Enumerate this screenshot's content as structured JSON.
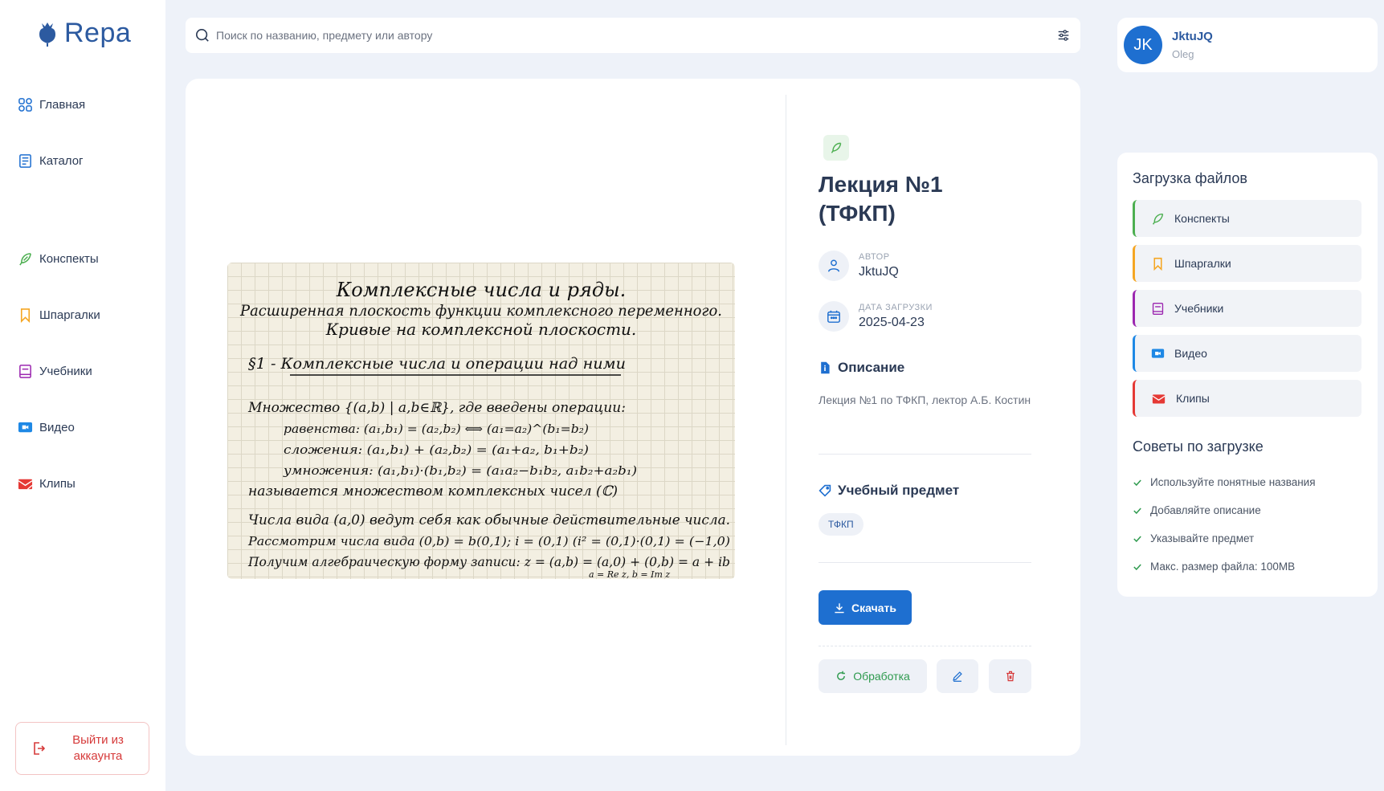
{
  "app": {
    "name": "Repa"
  },
  "sidebar": {
    "items": [
      {
        "label": "Главная",
        "icon": "grid-icon"
      },
      {
        "label": "Каталог",
        "icon": "catalog-icon"
      },
      {
        "label": "Конспекты",
        "icon": "feather-icon"
      },
      {
        "label": "Шпаргалки",
        "icon": "bookmark-icon"
      },
      {
        "label": "Учебники",
        "icon": "book-icon"
      },
      {
        "label": "Видео",
        "icon": "video-icon"
      },
      {
        "label": "Клипы",
        "icon": "clips-icon"
      }
    ],
    "logout_label": "Выйти из аккаунта"
  },
  "search": {
    "placeholder": "Поиск по названию, предмету или автору"
  },
  "document": {
    "title": "Лекция №1 (ТФКП)",
    "author_label": "АВТОР",
    "author": "JktuJQ",
    "date_label": "ДАТА ЗАГРУЗКИ",
    "date": "2025-04-23",
    "description_heading": "Описание",
    "description": "Лекция №1 по ТФКП, лектор А.Б. Костин",
    "subject_heading": "Учебный предмет",
    "subject_tag": "ТФКП",
    "download_label": "Скачать",
    "processing_label": "Обработка"
  },
  "preview_text": {
    "line1": "Комплексные числа и ряды.",
    "line2": "Расширенная плоскость функции комплексного переменного.",
    "line3": "Кривые на комплексной плоскости.",
    "line4": "§1 - Комплексные числа и операции над ними",
    "line5": "Множество {(a,b) | a,b∈ℝ}, где введены операции:",
    "line6": "равенства: (a₁,b₁) = (a₂,b₂) ⟺ (a₁=a₂)^(b₁=b₂)",
    "line7": "сложения: (a₁,b₁) + (a₂,b₂) = (a₁+a₂, b₁+b₂)",
    "line8": "умножения: (a₁,b₁)·(b₁,b₂) = (a₁a₂−b₁b₂, a₁b₂+a₂b₁)",
    "line9": "называется множеством комплексных чисел (ℂ)",
    "line10": "Числа вида (a,0) ведут себя как обычные действительные числа.",
    "line11": "Рассмотрим числа вида (0,b) = b(0,1); i = (0,1) (i² = (0,1)·(0,1) = (−1,0)",
    "line12": "Получим алгебраическую форму записи: z = (a,b) = (a,0) + (0,b) = a + ib",
    "line13": "a = Re z, b = Im z"
  },
  "user": {
    "initials": "JK",
    "name": "JktuJQ",
    "subtitle": "Oleg"
  },
  "upload": {
    "title": "Загрузка файлов",
    "items": [
      {
        "label": "Конспекты",
        "color": "#4caf50"
      },
      {
        "label": "Шпаргалки",
        "color": "#f5a623"
      },
      {
        "label": "Учебники",
        "color": "#9c27b0"
      },
      {
        "label": "Видео",
        "color": "#1e88e5"
      },
      {
        "label": "Клипы",
        "color": "#e53935"
      }
    ],
    "tips_title": "Советы по загрузке",
    "tips": [
      "Используйте понятные названия",
      "Добавляйте описание",
      "Указывайте предмет",
      "Макс. размер файла: 100MB"
    ]
  },
  "colors": {
    "accent": "#1e6fd0",
    "brand": "#2c5aa0",
    "danger": "#d63a3a",
    "success": "#2e9a4e"
  }
}
